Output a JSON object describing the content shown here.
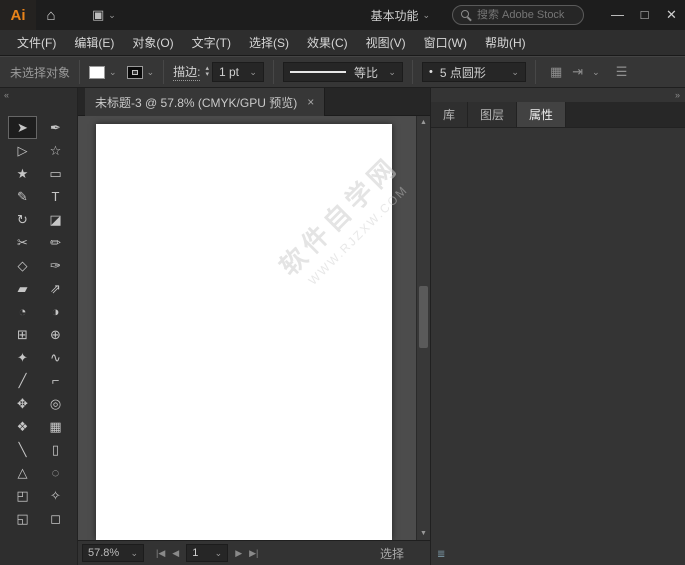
{
  "colors": {
    "brand_orange": "#E8831A",
    "titlebar_bg": "#1D1D1D",
    "panel_bg": "#333333",
    "canvas_bg": "#4C4C4C",
    "artboard": "#FFFFFF",
    "watermark_gray": "#CDCDCD"
  },
  "icons": {
    "home": "⌂",
    "workspace_switcher": "▣",
    "caret_down": "⌄",
    "minimize": "—",
    "maximize": "□",
    "close": "✕",
    "collapse_left": "«",
    "collapse_right": "»",
    "stepper_up": "▴",
    "stepper_down": "▾",
    "grid_options": "▦",
    "align_options": "⇥",
    "panel_menu": "☰",
    "bullet": "•",
    "tab_close": "×",
    "scroll_up": "▲",
    "scroll_down": "▼",
    "first_artboard": "|◀",
    "prev_artboard": "◀",
    "next_artboard": "▶",
    "last_artboard": "▶|",
    "panel_footer": "≣"
  },
  "titlebar": {
    "logo": "Ai",
    "workspace": "基本功能",
    "search_placeholder": "搜索 Adobe Stock"
  },
  "menubar": {
    "items": [
      "文件(F)",
      "编辑(E)",
      "对象(O)",
      "文字(T)",
      "选择(S)",
      "效果(C)",
      "视图(V)",
      "窗口(W)",
      "帮助(H)"
    ]
  },
  "controlbar": {
    "no_selection": "未选择对象",
    "stroke_label": "描边:",
    "stroke_width": "1 pt",
    "width_profile": "等比",
    "brush": "5 点圆形"
  },
  "toolbar": {
    "tools": [
      {
        "name": "selection",
        "glyph": "➤",
        "active": true
      },
      {
        "name": "curvature",
        "glyph": "✒"
      },
      {
        "name": "direct-selection",
        "glyph": "▷"
      },
      {
        "name": "magic-wand",
        "glyph": "☆"
      },
      {
        "name": "star",
        "glyph": "★"
      },
      {
        "name": "rectangle",
        "glyph": "▭"
      },
      {
        "name": "paintbrush",
        "glyph": "✎"
      },
      {
        "name": "type",
        "glyph": "T"
      },
      {
        "name": "rotate",
        "glyph": "↻"
      },
      {
        "name": "eraser",
        "glyph": "◪"
      },
      {
        "name": "scissors",
        "glyph": "✂"
      },
      {
        "name": "pencil",
        "glyph": "✏"
      },
      {
        "name": "width",
        "glyph": "◇"
      },
      {
        "name": "pen",
        "glyph": "✑"
      },
      {
        "name": "shape-builder",
        "glyph": "▰"
      },
      {
        "name": "scale",
        "glyph": "⇗"
      },
      {
        "name": "spiral",
        "glyph": "◔"
      },
      {
        "name": "gradient",
        "glyph": "◑"
      },
      {
        "name": "grid",
        "glyph": "⊞"
      },
      {
        "name": "mesh",
        "glyph": "⊕"
      },
      {
        "name": "shaper",
        "glyph": "✦"
      },
      {
        "name": "lasso",
        "glyph": "∿"
      },
      {
        "name": "knife",
        "glyph": "╱"
      },
      {
        "name": "ruler",
        "glyph": "⌐"
      },
      {
        "name": "hand",
        "glyph": "✥"
      },
      {
        "name": "zoom",
        "glyph": "◎"
      },
      {
        "name": "symbol-sprayer",
        "glyph": "❖"
      },
      {
        "name": "column-graph",
        "glyph": "▦"
      },
      {
        "name": "slice",
        "glyph": "╲"
      },
      {
        "name": "artboard",
        "glyph": "▯"
      },
      {
        "name": "perspective-grid",
        "glyph": "△"
      },
      {
        "name": "blend",
        "glyph": "◌"
      },
      {
        "name": "free-transform",
        "glyph": "◰"
      },
      {
        "name": "eyedropper",
        "glyph": "✧"
      },
      {
        "name": "fill-stroke",
        "glyph": "◱"
      },
      {
        "name": "drawing-mode",
        "glyph": "◻"
      }
    ]
  },
  "document": {
    "tab_title": "未标题-3 @ 57.8% (CMYK/GPU 预览)"
  },
  "canvas": {
    "watermark_line1": "软件自学网",
    "watermark_line2": "WWW.RJZXW.COM"
  },
  "statusbar": {
    "zoom": "57.8%",
    "artboard_number": "1",
    "mode": "选择"
  },
  "right_panel": {
    "tabs": [
      "库",
      "图层",
      "属性"
    ],
    "active_tab": "属性"
  }
}
